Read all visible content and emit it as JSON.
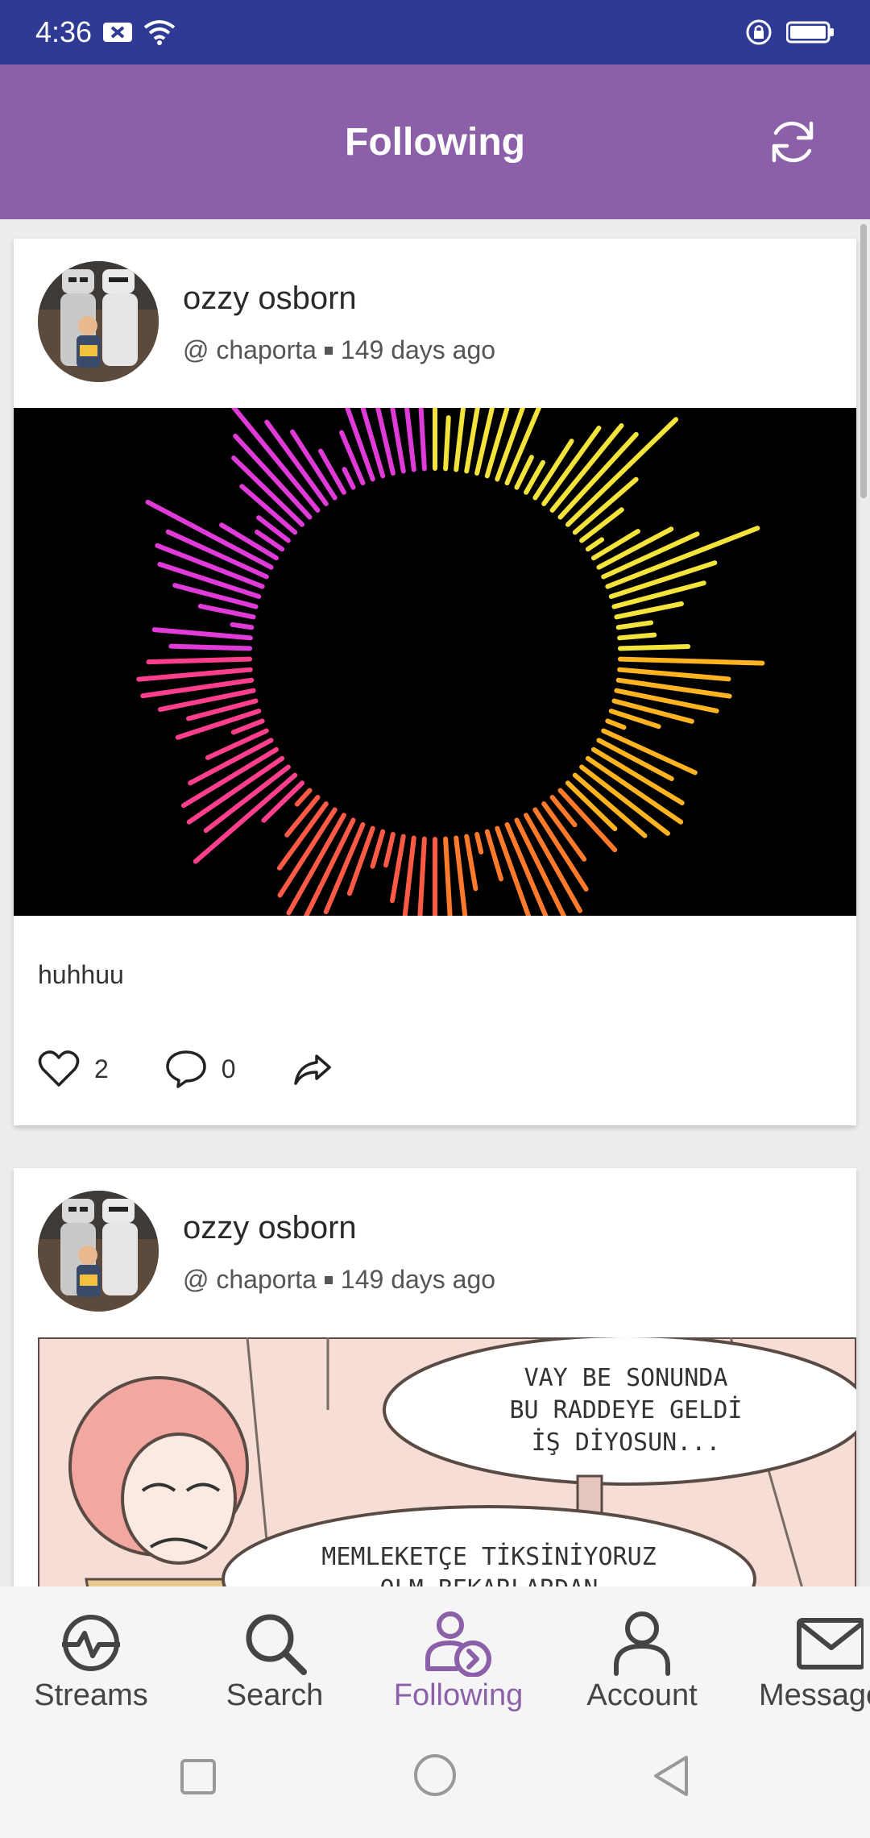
{
  "status_bar": {
    "time": "4:36"
  },
  "app_bar": {
    "title": "Following"
  },
  "posts": [
    {
      "user_name": "ozzy osborn",
      "handle": "@ chaporta",
      "time_ago": "149 days ago",
      "caption": "huhhuu",
      "likes": "2",
      "comments": "0"
    },
    {
      "user_name": "ozzy osborn",
      "handle": "@ chaporta",
      "time_ago": "149 days ago",
      "comic_text_1": "VAY BE SONUNDA BU RADDEYE GELDİ İŞ DİYOSUN...",
      "comic_text_2": "MEMLEKETÇE TİKSİNİYORUZ OLM BEKARLARDAN"
    }
  ],
  "bottom_nav": [
    {
      "label": "Streams",
      "icon": "streams-icon"
    },
    {
      "label": "Search",
      "icon": "search-icon"
    },
    {
      "label": "Following",
      "icon": "following-icon"
    },
    {
      "label": "Account",
      "icon": "account-icon"
    },
    {
      "label": "Messages",
      "icon": "mail-icon"
    }
  ],
  "colors": {
    "accent": "#8b60a8",
    "status_bar": "#2e3a93"
  }
}
